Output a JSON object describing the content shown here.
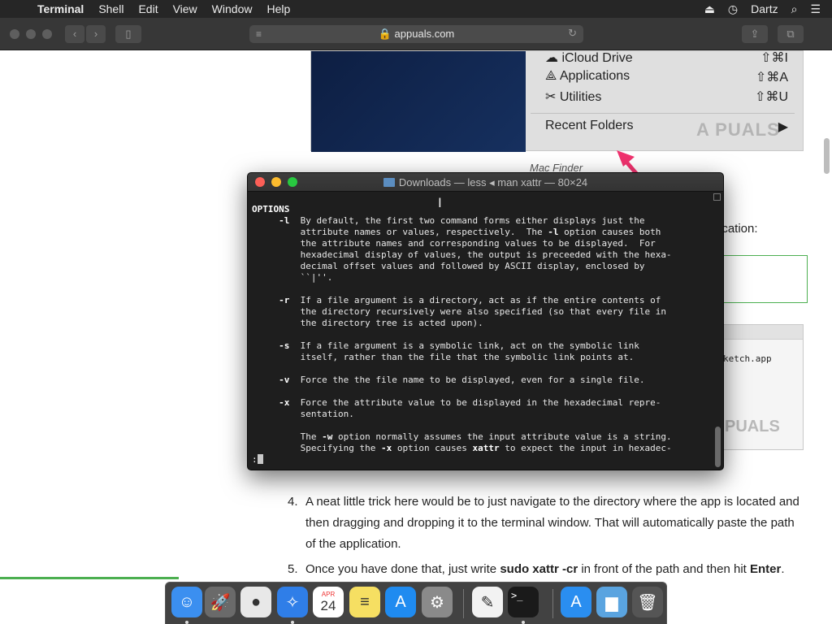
{
  "menubar": {
    "apple_glyph": "",
    "app": "Terminal",
    "items": [
      "Shell",
      "Edit",
      "View",
      "Window",
      "Help"
    ],
    "user": "Dartz"
  },
  "safari": {
    "url": "appuals.com"
  },
  "webpage": {
    "finder_menu": [
      {
        "label": "iCloud Drive",
        "shortcut": "⇧⌘I"
      },
      {
        "label": "Applications",
        "shortcut": "⇧⌘A"
      },
      {
        "label": "Utilities",
        "shortcut": "⇧⌘U"
      },
      {
        "label": "Recent Folders",
        "shortcut": "▶"
      }
    ],
    "finder_watermark": "A  PUALS",
    "caption": "Mac Finder",
    "partial_text": "ication:",
    "img2_filename": "ketch.app",
    "img2_watermark": "PUALS",
    "steps": [
      {
        "num": "4.",
        "text": "A neat little trick here would be to just navigate to the directory where the app is located and then dragging and dropping it to the terminal window. That will automatically paste the path of the application."
      },
      {
        "num": "5.",
        "pre": "Once you have done that, just write ",
        "cmd": "sudo xattr -cr",
        "mid": " in front of the path and then hit ",
        "key": "Enter",
        "post": "."
      }
    ]
  },
  "terminal": {
    "title": "Downloads — less ◂ man xattr — 80×24",
    "heading": "OPTIONS",
    "options": [
      {
        "flag": "-l",
        "lines": [
          "By default, the first two command forms either displays just the",
          "attribute names or values, respectively.  The -l option causes both",
          "the attribute names and corresponding values to be displayed.  For",
          "hexadecimal display of values, the output is preceeded with the hexa-",
          "decimal offset values and followed by ASCII display, enclosed by",
          "``|''."
        ]
      },
      {
        "flag": "-r",
        "lines": [
          "If a file argument is a directory, act as if the entire contents of",
          "the directory recursively were also specified (so that every file in",
          "the directory tree is acted upon)."
        ]
      },
      {
        "flag": "-s",
        "lines": [
          "If a file argument is a symbolic link, act on the symbolic link",
          "itself, rather than the file that the symbolic link points at."
        ]
      },
      {
        "flag": "-v",
        "lines": [
          "Force the the file name to be displayed, even for a single file."
        ]
      },
      {
        "flag": "-x",
        "lines": [
          "Force the attribute value to be displayed in the hexadecimal repre-",
          "sentation.",
          "",
          "The -w option normally assumes the input attribute value is a string.",
          "Specifying the -x option causes xattr to expect the input in hexadec-"
        ]
      }
    ],
    "prompt": ":"
  },
  "dock": {
    "apps": [
      {
        "name": "Finder",
        "glyph": "☺",
        "color": "#3b8ff0",
        "running": true
      },
      {
        "name": "Launchpad",
        "glyph": "🚀",
        "color": "#6a6a6a",
        "running": false
      },
      {
        "name": "Chrome",
        "glyph": "●",
        "color": "#e8e8e8",
        "running": false
      },
      {
        "name": "Safari",
        "glyph": "✧",
        "color": "#2f7ee8",
        "running": true
      },
      {
        "name": "Calendar",
        "glyph": "24",
        "month": "APR",
        "color": "#ffffff",
        "running": false
      },
      {
        "name": "Notes",
        "glyph": "≡",
        "color": "#f6df62",
        "running": false
      },
      {
        "name": "App Store",
        "glyph": "A",
        "color": "#1f8bf0",
        "running": false
      },
      {
        "name": "System Preferences",
        "glyph": "⚙",
        "color": "#8a8a8a",
        "running": false
      },
      {
        "name": "TextEdit",
        "glyph": "✎",
        "color": "#f2f2f2",
        "running": false
      },
      {
        "name": "Terminal",
        "glyph": ">_",
        "color": "#1a1a1a",
        "running": true
      },
      {
        "name": "App Store Downloads",
        "glyph": "A",
        "color": "#2a8ef0",
        "running": false
      },
      {
        "name": "Downloads Folder",
        "glyph": "▆",
        "color": "#5aa4e0",
        "running": false
      },
      {
        "name": "Trash",
        "glyph": "🗑",
        "color": "#555555",
        "running": false
      }
    ]
  }
}
